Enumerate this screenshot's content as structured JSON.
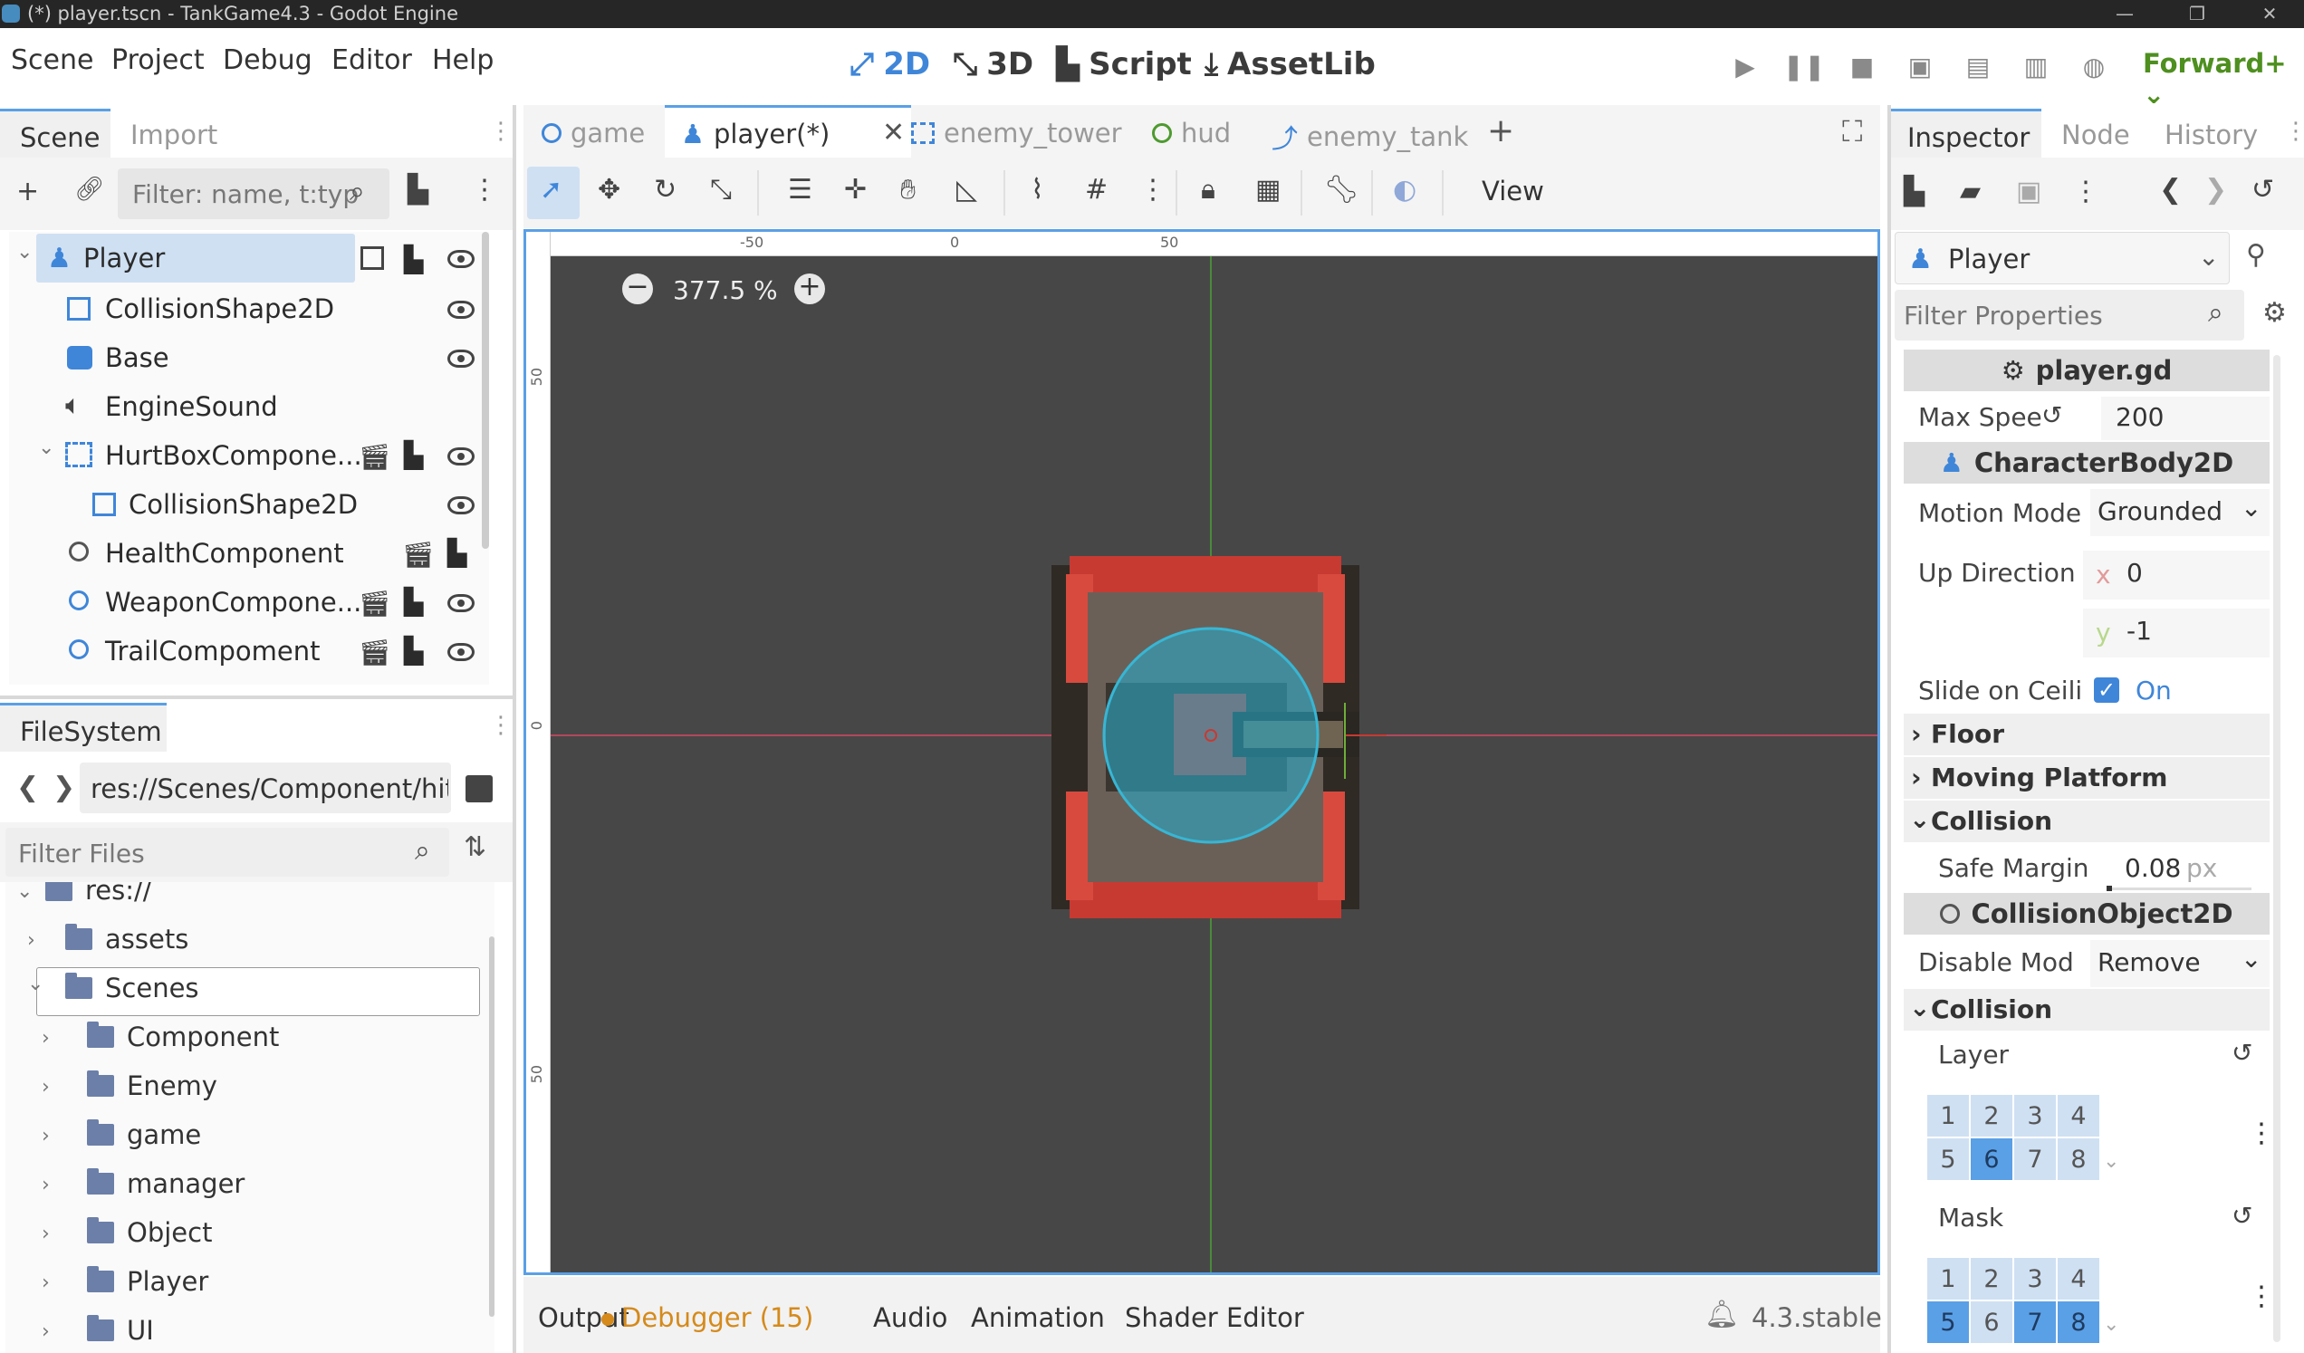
{
  "window": {
    "title": "(*) player.tscn - TankGame4.3 - Godot Engine"
  },
  "menu": [
    "Scene",
    "Project",
    "Debug",
    "Editor",
    "Help"
  ],
  "workspaces": [
    {
      "label": "2D",
      "icon": "2d-icon"
    },
    {
      "label": "3D",
      "icon": "3d-icon"
    },
    {
      "label": "Script",
      "icon": "script-icon"
    },
    {
      "label": "AssetLib",
      "icon": "assetlib-icon"
    }
  ],
  "renderer": "Forward+",
  "scene_dock": {
    "tabs": [
      "Scene",
      "Import"
    ],
    "filter_placeholder": "Filter: name, t:typ",
    "nodes": [
      {
        "label": "Player"
      },
      {
        "label": "CollisionShape2D"
      },
      {
        "label": "Base"
      },
      {
        "label": "EngineSound"
      },
      {
        "label": "HurtBoxCompone..."
      },
      {
        "label": "CollisionShape2D"
      },
      {
        "label": "HealthComponent"
      },
      {
        "label": "WeaponCompone..."
      },
      {
        "label": "TrailCompoment"
      }
    ]
  },
  "filesystem": {
    "tab": "FileSystem",
    "path": "res://Scenes/Component/hit_",
    "filter_placeholder": "Filter Files",
    "items": [
      {
        "label": "res://"
      },
      {
        "label": "assets"
      },
      {
        "label": "Scenes"
      },
      {
        "label": "Component"
      },
      {
        "label": "Enemy"
      },
      {
        "label": "game"
      },
      {
        "label": "manager"
      },
      {
        "label": "Object"
      },
      {
        "label": "Player"
      },
      {
        "label": "UI"
      }
    ]
  },
  "editor_tabs": [
    {
      "label": "game",
      "icon": "node-circle-icon"
    },
    {
      "label": "player(*)",
      "icon": "character-icon"
    },
    {
      "label": "enemy_tower",
      "icon": "dashed-rect-icon"
    },
    {
      "label": "hud",
      "icon": "node-circle-icon"
    },
    {
      "label": "enemy_tank",
      "icon": "path-icon"
    }
  ],
  "viewport": {
    "zoom": "377.5 %",
    "view_label": "View",
    "ruler_top": [
      "-50",
      "0",
      "50"
    ],
    "ruler_left": [
      "50",
      "0",
      "50"
    ]
  },
  "inspector": {
    "tabs": [
      "Inspector",
      "Node",
      "History"
    ],
    "object": "Player",
    "filter_placeholder": "Filter Properties",
    "script": "player.gd",
    "max_speed_label": "Max Spee",
    "max_speed_value": "200",
    "class1": "CharacterBody2D",
    "motion_mode_label": "Motion Mode",
    "motion_mode_value": "Grounded",
    "up_direction_label": "Up Direction",
    "up_x_label": "x",
    "up_x": "0",
    "up_y_label": "y",
    "up_y": "-1",
    "slide_label": "Slide on Ceili",
    "slide_value": "On",
    "floor": "Floor",
    "moving_platform": "Moving Platform",
    "collision1": "Collision",
    "safe_margin_label": "Safe Margin",
    "safe_margin_value": "0.08",
    "safe_margin_unit": "px",
    "class2": "CollisionObject2D",
    "disable_mode_label": "Disable Mod",
    "disable_mode_value": "Remove",
    "collision2": "Collision",
    "layer_label": "Layer",
    "mask_label": "Mask",
    "bits": [
      "1",
      "2",
      "3",
      "4",
      "5",
      "6",
      "7",
      "8"
    ],
    "layer_on": [
      6
    ],
    "mask_on": [
      5,
      7,
      8
    ]
  },
  "bottom": {
    "tabs": [
      "Output",
      "Debugger (15)",
      "Audio",
      "Animation",
      "Shader Editor"
    ],
    "version": "4.3.stable"
  },
  "colors": {
    "accent": "#3f86d9",
    "renderer": "#4e8f1f",
    "debugger": "#d58a1b"
  }
}
